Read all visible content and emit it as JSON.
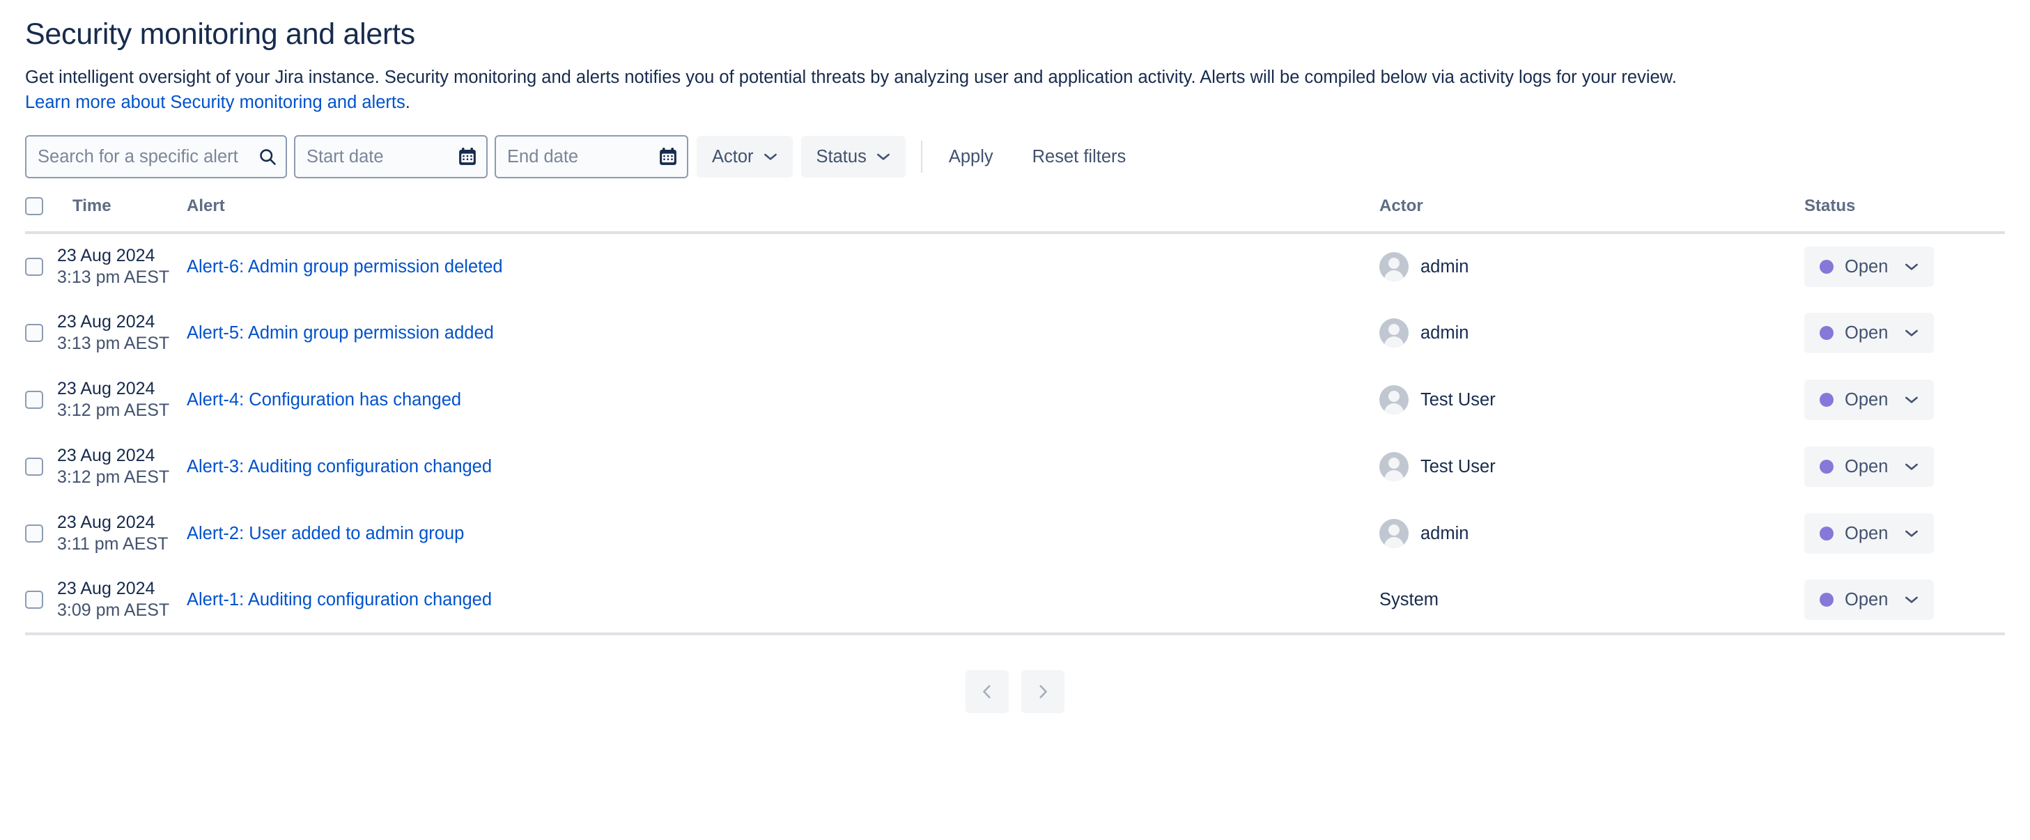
{
  "header": {
    "title": "Security monitoring and alerts",
    "description": "Get intelligent oversight of your Jira instance. Security monitoring and alerts notifies you of potential threats by analyzing user and application activity. Alerts will be compiled below via activity logs for your review.",
    "learn_more_link": "Learn more about Security monitoring and alerts",
    "learn_more_suffix": "."
  },
  "filters": {
    "search_placeholder": "Search for a specific alert",
    "search_value": "",
    "search_icon": "search-icon",
    "start_date_placeholder": "Start date",
    "start_date_value": "",
    "end_date_placeholder": "End date",
    "end_date_value": "",
    "calendar_icon": "calendar-icon",
    "actor_label": "Actor",
    "status_label": "Status",
    "chevron_icon": "chevron-down-icon",
    "apply_label": "Apply",
    "reset_label": "Reset filters"
  },
  "table": {
    "columns": [
      "Time",
      "Alert",
      "Actor",
      "Status"
    ],
    "select_all_checked": false,
    "rows": [
      {
        "checked": false,
        "date": "23 Aug 2024",
        "time": "3:13 pm AEST",
        "alert": "Alert-6: Admin group permission deleted",
        "actor": "admin",
        "has_avatar": true,
        "status": "Open",
        "status_color": "#8777d9"
      },
      {
        "checked": false,
        "date": "23 Aug 2024",
        "time": "3:13 pm AEST",
        "alert": "Alert-5: Admin group permission added",
        "actor": "admin",
        "has_avatar": true,
        "status": "Open",
        "status_color": "#8777d9"
      },
      {
        "checked": false,
        "date": "23 Aug 2024",
        "time": "3:12 pm AEST",
        "alert": "Alert-4: Configuration has changed",
        "actor": "Test User",
        "has_avatar": true,
        "status": "Open",
        "status_color": "#8777d9"
      },
      {
        "checked": false,
        "date": "23 Aug 2024",
        "time": "3:12 pm AEST",
        "alert": "Alert-3: Auditing configuration changed",
        "actor": "Test User",
        "has_avatar": true,
        "status": "Open",
        "status_color": "#8777d9"
      },
      {
        "checked": false,
        "date": "23 Aug 2024",
        "time": "3:11 pm AEST",
        "alert": "Alert-2: User added to admin group",
        "actor": "admin",
        "has_avatar": true,
        "status": "Open",
        "status_color": "#8777d9"
      },
      {
        "checked": false,
        "date": "23 Aug 2024",
        "time": "3:09 pm AEST",
        "alert": "Alert-1: Auditing configuration changed",
        "actor": "System",
        "has_avatar": false,
        "status": "Open",
        "status_color": "#8777d9"
      }
    ]
  },
  "pagination": {
    "prev_icon": "chevron-left-icon",
    "next_icon": "chevron-right-icon"
  },
  "colors": {
    "link": "#0052cc",
    "text": "#172b4d",
    "muted": "#5e6c84",
    "status_open": "#8777d9",
    "control_bg": "#f4f5f7",
    "border": "#dfe1e6"
  }
}
